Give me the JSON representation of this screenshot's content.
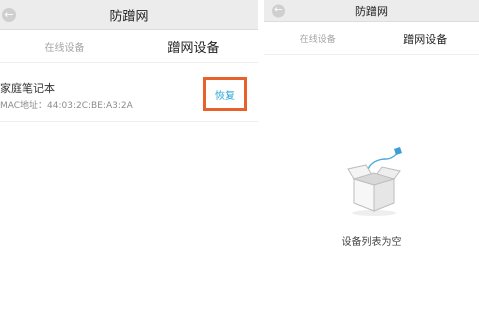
{
  "colors": {
    "accent": "#29a6d8",
    "highlight_border": "#e8612c",
    "topbar_bg": "#ececec"
  },
  "left_screen": {
    "header": {
      "back_icon": "back-arrow-icon",
      "back_glyph": "←",
      "title": "防蹭网"
    },
    "tabs": {
      "online": "在线设备",
      "blocked": "蹭网设备"
    },
    "device": {
      "name": "家庭笔记本",
      "mac": "MAC地址：44:03:2C:BE:A3:2A",
      "restore_label": "恢复"
    }
  },
  "right_screen": {
    "header": {
      "back_icon": "back-arrow-icon",
      "back_glyph": "←",
      "title": "防蹭网"
    },
    "tabs": {
      "online": "在线设备",
      "blocked": "蹭网设备"
    },
    "empty": {
      "icon": "empty-box-icon",
      "text": "设备列表为空"
    }
  }
}
